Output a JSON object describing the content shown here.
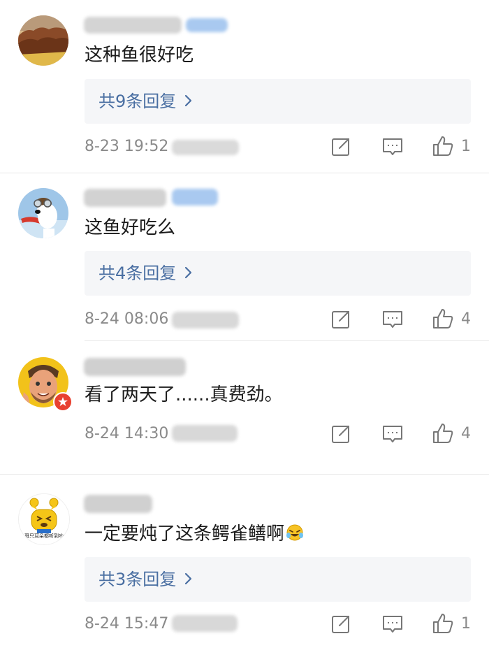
{
  "comments": [
    {
      "avatar": "canyon-landscape-avatar",
      "text": "这种鱼很好吃",
      "replies_label": "共9条回复",
      "time": "8-23 19:52",
      "likes": "1"
    },
    {
      "avatar": "snoopy-pilot-avatar",
      "text": "这鱼好吃么",
      "replies_label": "共4条回复",
      "time": "8-24 08:06",
      "likes": "4"
    },
    {
      "avatar": "cartoon-man-avatar",
      "text": "看了两天了......真费劲。",
      "replies_label": "",
      "time": "8-24 14:30",
      "likes": "4"
    },
    {
      "avatar": "yellow-mascot-avatar",
      "avatar_caption": "哥只耳朵都听到吵",
      "text": "一定要炖了这条鳄雀鳝啊",
      "replies_label": "共3条回复",
      "time": "8-24 15:47",
      "likes": "1"
    }
  ],
  "icons": {
    "share": "share-icon",
    "comment": "comment-icon",
    "like": "thumbs-up-icon",
    "chevron": "chevron-right-icon",
    "emoji": "laugh-cry-emoji-icon"
  },
  "colors": {
    "reply_link": "#4a6fa2",
    "reply_bg": "#f5f6f8",
    "meta_gray": "#8a8a8a",
    "badge_red": "#e8402f"
  }
}
